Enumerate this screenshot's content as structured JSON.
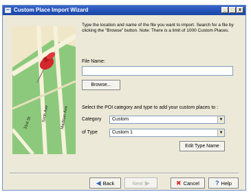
{
  "window": {
    "title": "Custom Place Import Wizard"
  },
  "titlebar_buttons": {
    "minimize": "_",
    "maximize": "□",
    "close": "x"
  },
  "instructions": "Type the location and name of the file you want to import. Search for a file by clicking the \"Browse\" button. Note: There is a limit of 1000 Custom Places.",
  "file_name": {
    "label": "File Name:",
    "value": ""
  },
  "browse_button": "Browse...",
  "poi_prompt": "Select the POI category and type to add your custom places to :",
  "category": {
    "label": "Category",
    "value": "Custom"
  },
  "type": {
    "label": "of Type",
    "value": "Custom 1"
  },
  "edit_type_button": "Edit Type Name",
  "map": {
    "streets": [
      "Sixth Ave",
      "Madison Ave",
      "31st St"
    ]
  },
  "footer": {
    "back": "Back",
    "next": "Next",
    "cancel": "Cancel",
    "help": "Help"
  },
  "colors": {
    "title_bar": "#2452b8",
    "map_green": "#8cc97c",
    "map_land": "#efe7c8",
    "pin_red": "#d4262d"
  }
}
